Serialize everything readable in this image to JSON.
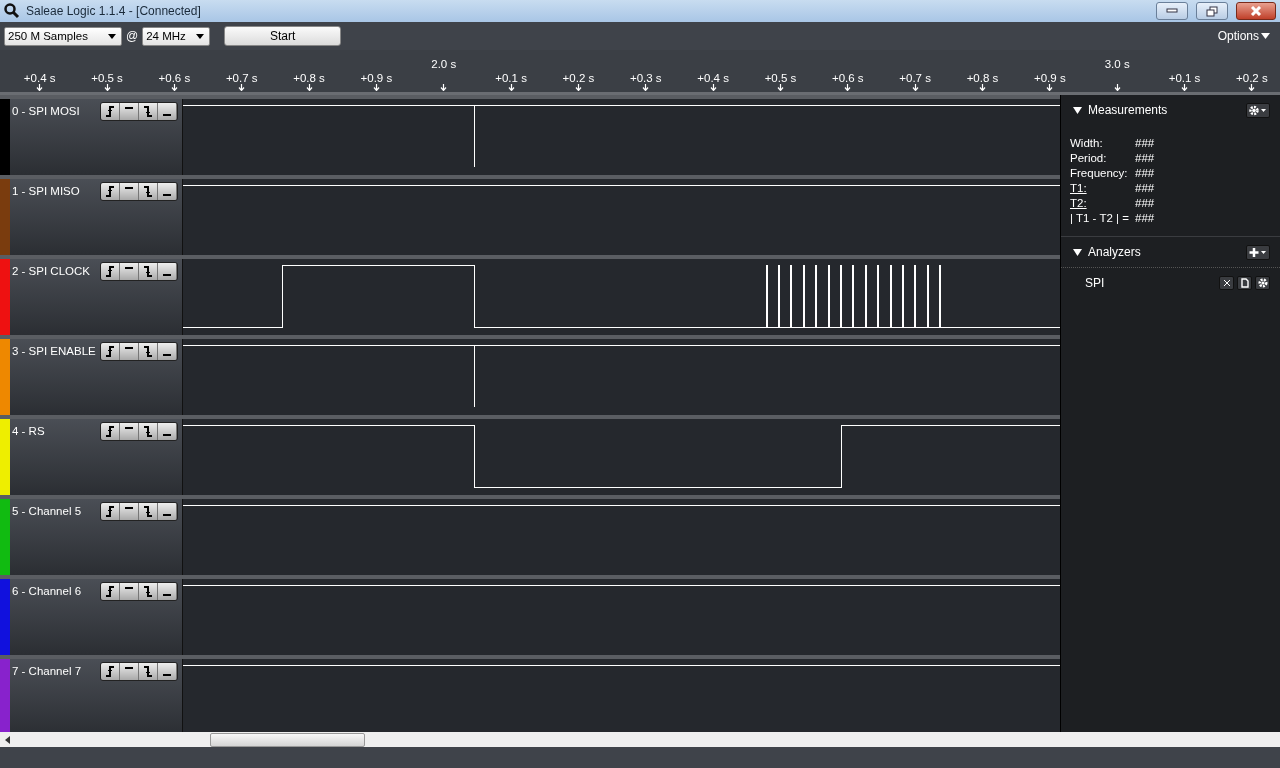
{
  "window": {
    "title": "Saleae Logic 1.1.4 - [Connected]"
  },
  "toolbar": {
    "samples": "250 M Samples",
    "at": "@",
    "rate": "24 MHz",
    "start": "Start",
    "options": "Options"
  },
  "ruler": [
    {
      "label": "+0.4 s",
      "major": false
    },
    {
      "label": "+0.5 s",
      "major": false
    },
    {
      "label": "+0.6 s",
      "major": false
    },
    {
      "label": "+0.7 s",
      "major": false
    },
    {
      "label": "+0.8 s",
      "major": false
    },
    {
      "label": "+0.9 s",
      "major": false
    },
    {
      "label": "2.0 s",
      "major": true
    },
    {
      "label": "+0.1 s",
      "major": false
    },
    {
      "label": "+0.2 s",
      "major": false
    },
    {
      "label": "+0.3 s",
      "major": false
    },
    {
      "label": "+0.4 s",
      "major": false
    },
    {
      "label": "+0.5 s",
      "major": false
    },
    {
      "label": "+0.6 s",
      "major": false
    },
    {
      "label": "+0.7 s",
      "major": false
    },
    {
      "label": "+0.8 s",
      "major": false
    },
    {
      "label": "+0.9 s",
      "major": false
    },
    {
      "label": "3.0 s",
      "major": true
    },
    {
      "label": "+0.1 s",
      "major": false
    },
    {
      "label": "+0.2 s",
      "major": false
    }
  ],
  "channels": [
    {
      "name": "0 - SPI MOSI",
      "color": "#000000",
      "kind": "high-glitch"
    },
    {
      "name": "1 - SPI MISO",
      "color": "#7a3c0e",
      "kind": "high"
    },
    {
      "name": "2 - SPI CLOCK",
      "color": "#ee1111",
      "kind": "clock"
    },
    {
      "name": "3 - SPI ENABLE",
      "color": "#ee8800",
      "kind": "high-glitch"
    },
    {
      "name": "4 - RS",
      "color": "#eeee00",
      "kind": "low-pulse"
    },
    {
      "name": "5 - Channel 5",
      "color": "#11bb11",
      "kind": "high"
    },
    {
      "name": "6 - Channel 6",
      "color": "#1111dd",
      "kind": "high"
    },
    {
      "name": "7 - Channel 7",
      "color": "#8822cc",
      "kind": "high"
    }
  ],
  "measurements": {
    "title": "Measurements",
    "rows": [
      {
        "label": "Width:",
        "value": "###"
      },
      {
        "label": "Period:",
        "value": "###"
      },
      {
        "label": "Frequency:",
        "value": "###"
      },
      {
        "label": "T1:",
        "value": "###"
      },
      {
        "label": "T2:",
        "value": "###"
      },
      {
        "label": "| T1 - T2 | =",
        "value": "###"
      }
    ]
  },
  "analyzers": {
    "title": "Analyzers",
    "items": [
      "SPI"
    ]
  }
}
